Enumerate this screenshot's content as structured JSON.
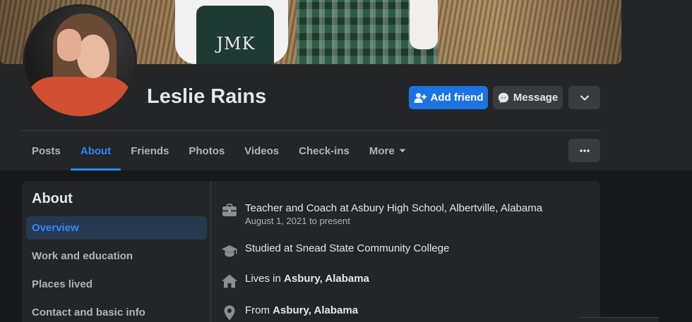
{
  "cover": {
    "monogram": "JMK"
  },
  "profile": {
    "name": "Leslie Rains"
  },
  "actions": {
    "add_friend": "Add friend",
    "message": "Message"
  },
  "tabs": [
    {
      "label": "Posts"
    },
    {
      "label": "About"
    },
    {
      "label": "Friends"
    },
    {
      "label": "Photos"
    },
    {
      "label": "Videos"
    },
    {
      "label": "Check-ins"
    },
    {
      "label": "More"
    }
  ],
  "about": {
    "title": "About",
    "nav": [
      {
        "label": "Overview"
      },
      {
        "label": "Work and education"
      },
      {
        "label": "Places lived"
      },
      {
        "label": "Contact and basic info"
      }
    ],
    "entries": {
      "work": {
        "text": "Teacher and Coach at Asbury High School, Albertville, Alabama",
        "sub": "August 1, 2021 to present",
        "icon": "briefcase-icon"
      },
      "education": {
        "text": "Studied at Snead State Community College",
        "icon": "graduation-cap-icon"
      },
      "lives": {
        "prefix": "Lives in ",
        "place": "Asbury, Alabama",
        "icon": "home-icon"
      },
      "from": {
        "prefix": "From ",
        "place": "Asbury, Alabama",
        "icon": "location-pin-icon"
      }
    }
  },
  "colors": {
    "accent": "#2d88ff",
    "primary_button": "#1b74e4",
    "surface": "#242526",
    "background": "#18191a"
  }
}
